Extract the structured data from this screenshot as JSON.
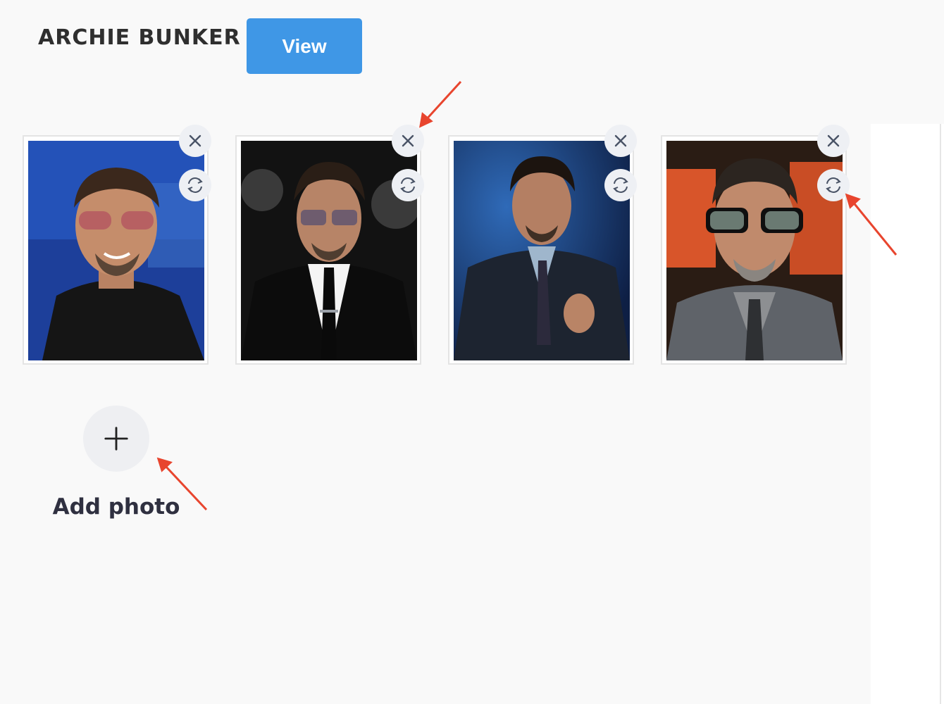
{
  "header": {
    "name": "ARCHIE BUNKER",
    "view_label": "View"
  },
  "colors": {
    "accent": "#3f97e6",
    "annotation_arrow": "#e8452e",
    "page_background": "#f9f9f9",
    "round_button_bg": "#eef0f4"
  },
  "photos": [
    {
      "remove_icon": "close-icon",
      "replace_icon": "refresh-icon"
    },
    {
      "remove_icon": "close-icon",
      "replace_icon": "refresh-icon"
    },
    {
      "remove_icon": "close-icon",
      "replace_icon": "refresh-icon"
    },
    {
      "remove_icon": "close-icon",
      "replace_icon": "refresh-icon"
    }
  ],
  "add_photo": {
    "label": "Add photo",
    "icon": "plus-icon"
  }
}
